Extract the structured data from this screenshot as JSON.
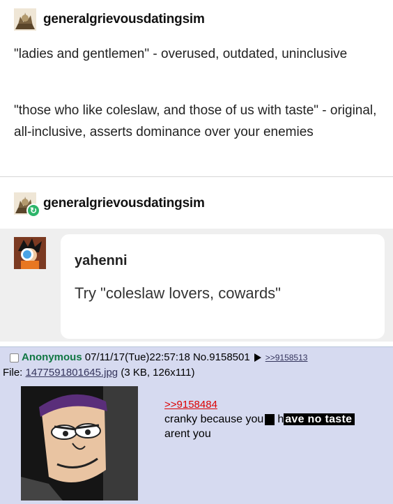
{
  "post1": {
    "username": "generalgrievousdatingsim",
    "paragraphs": [
      "\"ladies and gentlemen\" - overused, outdated, uninclusive",
      "\"those who like coleslaw, and those of us with taste\" - original, all-inclusive, asserts dominance over your enemies"
    ]
  },
  "post2": {
    "username": "generalgrievousdatingsim"
  },
  "reply": {
    "username": "yahenni",
    "text": "Try \"coleslaw lovers, cowards\""
  },
  "chan": {
    "name": "Anonymous",
    "datetime": "07/11/17(Tue)22:57:18",
    "post_no": "No.9158501",
    "backlink": ">>9158513",
    "file_label": "File:",
    "file_name": "1477591801645.jpg",
    "file_meta": "(3 KB, 126x111)",
    "quote": ">>9158484",
    "line1_pre": "cranky because you",
    "line1_h": "h",
    "line1_highlight": "ave no taste",
    "line2": "arent you"
  },
  "colors": {
    "chan_bg": "#d6daf0",
    "anon_name": "#117743",
    "reblog_green": "#2db56a",
    "reply_blue": "#4aa3e6"
  }
}
